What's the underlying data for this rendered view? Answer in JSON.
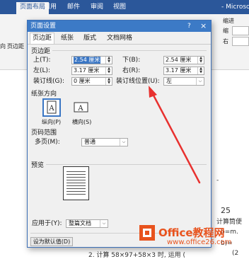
{
  "app": {
    "title_fragment": "- Microsoft"
  },
  "ribbon": {
    "tabs": [
      "页面布局",
      "引用",
      "邮件",
      "审阅",
      "视图"
    ],
    "right_group_label": "缩进",
    "indent_left_prefix": "缩",
    "indent_right_prefix": "右",
    "left_buttons": [
      "向",
      "页边距"
    ]
  },
  "document": {
    "right_fragments": [
      "-",
      "25",
      "计算筒便",
      "b=m.",
      "b)="
    ],
    "bottom_line": "2. 计算 58×97+58×3 时, 运用 (",
    "bottom_right": "(2"
  },
  "dialog": {
    "title": "页面设置",
    "title_buttons": [
      "?",
      "×"
    ],
    "tabs": [
      "页边距",
      "纸张",
      "版式",
      "文档网格"
    ],
    "margins": {
      "section": "页边距",
      "top_label": "上(T):",
      "top_value": "2.54 厘米",
      "bottom_label": "下(B):",
      "bottom_value": "2.54 厘米",
      "left_label": "左(L):",
      "left_value": "3.17 厘米",
      "right_label": "右(R):",
      "right_value": "3.17 厘米",
      "gutter_label": "装订线(G):",
      "gutter_value": "0 厘米",
      "gutter_pos_label": "装订线位置(U):",
      "gutter_pos_value": "左"
    },
    "orientation": {
      "section": "纸张方向",
      "portrait": "纵向(P)",
      "landscape": "横向(S)",
      "selected": "portrait"
    },
    "pages": {
      "section": "页码范围",
      "multiple_label": "多页(M):",
      "multiple_value": "普通"
    },
    "preview": {
      "section": "预览"
    },
    "apply_label": "应用于(Y):",
    "apply_value": "整篇文档",
    "default_button": "设为默认值(D)"
  },
  "watermark": {
    "brand": "Office教程网",
    "url": "www.office26.com"
  },
  "colors": {
    "ribbon": "#2b579a",
    "dialog_title": "#3c7ac6",
    "arrow": "#e8312f",
    "watermark": "#e8531e"
  }
}
